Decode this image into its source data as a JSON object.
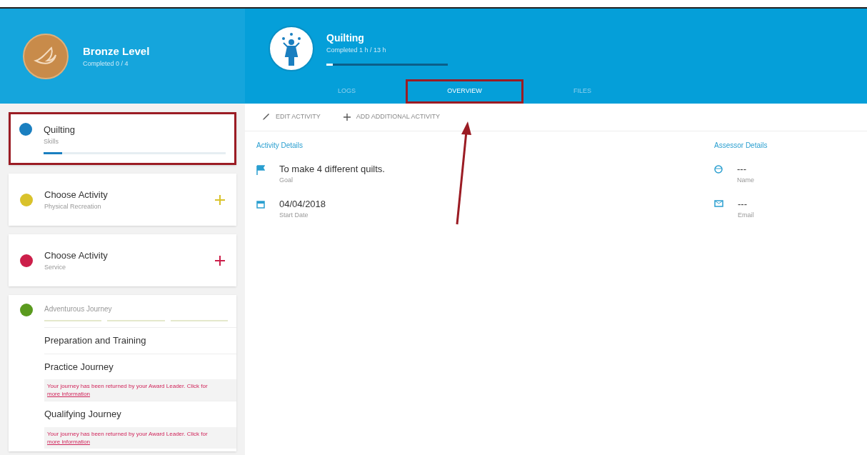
{
  "level_card": {
    "title": "Bronze Level",
    "subtitle": "Completed 0 / 4"
  },
  "activity_header": {
    "title": "Quilting",
    "subtitle": "Completed 1 h / 13 h",
    "level": 0.05
  },
  "tabs": [
    {
      "label": "LOGS",
      "selected": false,
      "highlighted": false
    },
    {
      "label": "OVERVIEW",
      "selected": true,
      "highlighted": true
    },
    {
      "label": "FILES",
      "selected": false,
      "highlighted": false
    }
  ],
  "sections": [
    {
      "kind": "activity",
      "title": "Quilting",
      "subtitle": "Skills",
      "color": "#1a7fc0",
      "level": 0.1,
      "highlighted": true
    },
    {
      "kind": "choose",
      "title": "Choose Activity",
      "subtitle": "Physical Recreation",
      "color": "#d9c22b"
    },
    {
      "kind": "choose",
      "title": "Choose Activity",
      "subtitle": "Service",
      "color": "#cc1f4a"
    },
    {
      "kind": "journey",
      "title": "Adventurous Journey",
      "color": "#5a9a1e",
      "steps": [
        {
          "title": "Preparation and Training"
        },
        {
          "title": "Practice Journey",
          "message": "Your journey has been returned by your Award Leader. Click for ",
          "link": "more information"
        },
        {
          "title": "Qualifying Journey",
          "message": "Your journey has been returned by your Award Leader. Click for ",
          "link": "more information"
        }
      ]
    }
  ],
  "actions": [
    {
      "kind": "edit",
      "label": "EDIT ACTIVITY"
    },
    {
      "kind": "add",
      "label": "ADD ADDITIONAL ACTIVITY"
    }
  ],
  "activity_details": {
    "heading": "Activity Details",
    "fields": [
      {
        "kind": "flag",
        "value": "To make 4 different quilts.",
        "label": "Goal"
      },
      {
        "kind": "calendar",
        "value": "04/04/2018",
        "label": "Start Date"
      }
    ]
  },
  "assessor_details": {
    "heading": "Assessor Details",
    "fields": [
      {
        "kind": "person",
        "value": "---",
        "label": "Name"
      },
      {
        "kind": "mail",
        "value": "---",
        "label": "Email"
      }
    ]
  }
}
